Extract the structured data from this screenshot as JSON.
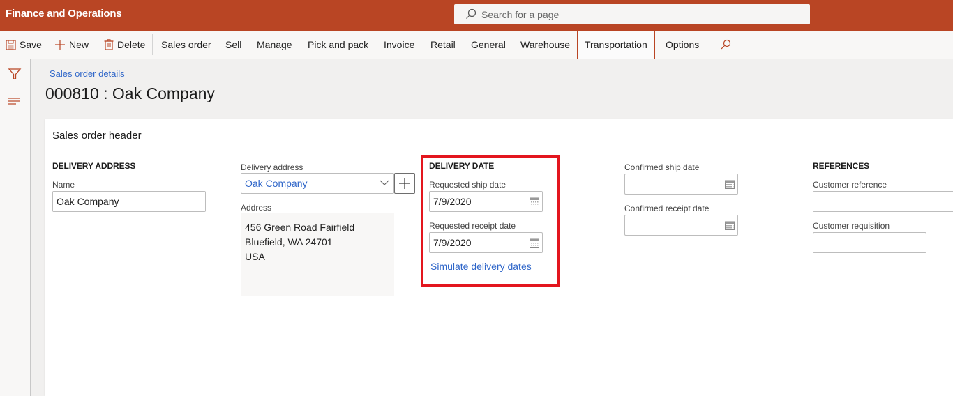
{
  "app": {
    "title": "Finance and Operations"
  },
  "search": {
    "placeholder": "Search for a page"
  },
  "actionbar": {
    "save": "Save",
    "new": "New",
    "delete": "Delete",
    "tabs": [
      "Sales order",
      "Sell",
      "Manage",
      "Pick and pack",
      "Invoice",
      "Retail",
      "General",
      "Warehouse",
      "Transportation",
      "Options"
    ],
    "selected_tab": "Transportation"
  },
  "breadcrumb": "Sales order details",
  "page_title": "000810 : Oak Company",
  "card": {
    "title": "Sales order header",
    "delivery_address_group": {
      "title": "DELIVERY ADDRESS",
      "name_label": "Name",
      "name_value": "Oak Company",
      "delivery_address_label": "Delivery address",
      "delivery_address_value": "Oak Company",
      "address_label": "Address",
      "address_lines": [
        "456 Green Road Fairfield",
        "Bluefield, WA 24701",
        "USA"
      ]
    },
    "delivery_date_group": {
      "title": "DELIVERY DATE",
      "requested_ship_label": "Requested ship date",
      "requested_ship_value": "7/9/2020",
      "requested_receipt_label": "Requested receipt date",
      "requested_receipt_value": "7/9/2020",
      "simulate_link": "Simulate delivery dates"
    },
    "confirmed_group": {
      "confirmed_ship_label": "Confirmed ship date",
      "confirmed_ship_value": "",
      "confirmed_receipt_label": "Confirmed receipt date",
      "confirmed_receipt_value": ""
    },
    "references_group": {
      "title": "REFERENCES",
      "customer_reference_label": "Customer reference",
      "customer_reference_value": "",
      "customer_requisition_label": "Customer requisition",
      "customer_requisition_value": ""
    }
  },
  "colors": {
    "brand": "#b94524",
    "link": "#2f66c9",
    "highlight": "#e3161e"
  }
}
